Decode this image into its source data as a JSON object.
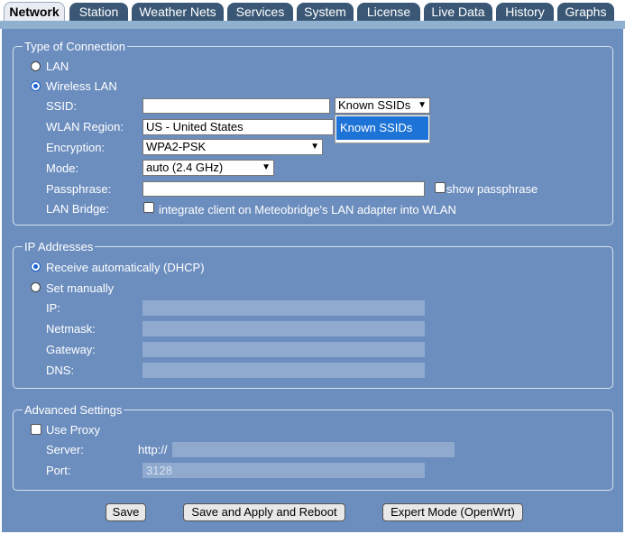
{
  "tabs": [
    {
      "label": "Network",
      "active": true
    },
    {
      "label": "Station"
    },
    {
      "label": "Weather Nets"
    },
    {
      "label": "Services"
    },
    {
      "label": "System"
    },
    {
      "label": "License"
    },
    {
      "label": "Live Data"
    },
    {
      "label": "History"
    },
    {
      "label": "Graphs"
    }
  ],
  "connection": {
    "legend": "Type of Connection",
    "lan_label": "LAN",
    "wlan_label": "Wireless LAN",
    "selected": "Wireless LAN",
    "ssid_label": "SSID:",
    "ssid_value": "",
    "ssid_select": "Known SSIDs",
    "ssid_dropdown_option": "Known SSIDs",
    "region_label": "WLAN Region:",
    "region_value": "US - United States",
    "encryption_label": "Encryption:",
    "encryption_value": "WPA2-PSK",
    "mode_label": "Mode:",
    "mode_value": "auto (2.4 GHz)",
    "passphrase_label": "Passphrase:",
    "passphrase_value": "",
    "show_passphrase_label": "show passphrase",
    "show_passphrase_checked": false,
    "bridge_label": "LAN Bridge:",
    "bridge_checkbox_label": "integrate client on Meteobridge's LAN adapter into WLAN",
    "bridge_checked": false
  },
  "ip": {
    "legend": "IP Addresses",
    "dhcp_label": "Receive automatically (DHCP)",
    "manual_label": "Set manually",
    "selected": "Receive automatically (DHCP)",
    "ip_label": "IP:",
    "netmask_label": "Netmask:",
    "gateway_label": "Gateway:",
    "dns_label": "DNS:"
  },
  "advanced": {
    "legend": "Advanced Settings",
    "proxy_label": "Use Proxy",
    "proxy_checked": false,
    "server_label": "Server:",
    "server_prefix": "http://",
    "server_value": "",
    "port_label": "Port:",
    "port_value": "3128"
  },
  "buttons": {
    "save": "Save",
    "save_reboot": "Save and Apply and Reboot",
    "expert": "Expert Mode (OpenWrt)"
  },
  "colors": {
    "panel": "#6c8ebf",
    "tab": "#3a5876",
    "disabled_input": "#8fa9cf",
    "dropdown_highlight": "#1e74d6"
  }
}
